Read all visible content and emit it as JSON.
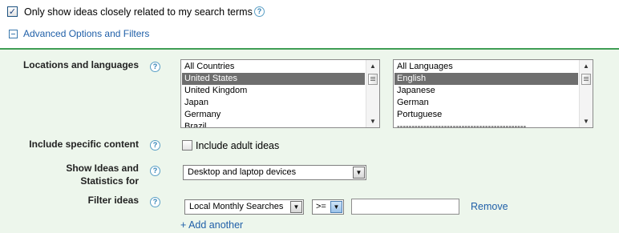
{
  "top": {
    "only_related_label": "Only show ideas closely related to my search terms",
    "advanced_label": "Advanced Options and Filters"
  },
  "panel": {
    "locations_label": "Locations and languages",
    "locations_list": [
      "All Countries",
      "United States",
      "United Kingdom",
      "Japan",
      "Germany",
      "Brazil"
    ],
    "locations_selected": "United States",
    "languages_list": [
      "All Languages",
      "English",
      "Japanese",
      "German",
      "Portuguese",
      "--------------------------------------------"
    ],
    "languages_selected": "English",
    "include_content_label": "Include specific content",
    "adult_ideas_label": "Include adult ideas",
    "show_ideas_label_1": "Show Ideas and",
    "show_ideas_label_2": "Statistics for",
    "devices_value": "Desktop and laptop devices",
    "filter_label": "Filter ideas",
    "filter_field_value": "Local Monthly Searches",
    "operator_value": ">=",
    "filter_input_value": "",
    "remove_label": "Remove",
    "add_another_label": "+ Add another"
  },
  "icons": {
    "help": "?",
    "checkmark": "✓",
    "arrow_down": "▼",
    "arrow_up": "▲"
  }
}
